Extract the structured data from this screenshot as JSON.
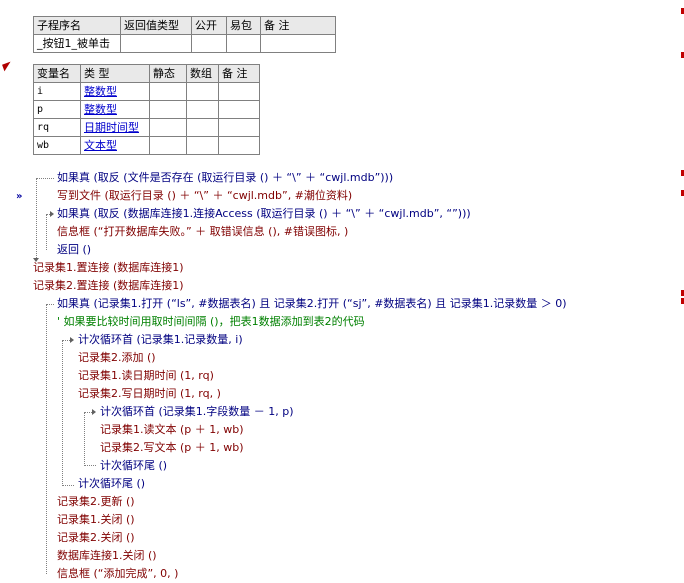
{
  "sub_table": {
    "headers": [
      "子程序名",
      "返回值类型",
      "公开",
      "易包",
      "备 注"
    ],
    "row": [
      "_按钮1_被单击",
      "",
      "",
      "",
      ""
    ]
  },
  "var_table": {
    "headers": [
      "变量名",
      "类 型",
      "静态",
      "数组",
      "备 注"
    ],
    "rows": [
      [
        "i",
        "整数型",
        "",
        "",
        ""
      ],
      [
        "p",
        "整数型",
        "",
        "",
        ""
      ],
      [
        "rq",
        "日期时间型",
        "",
        "",
        ""
      ],
      [
        "wb",
        "文本型",
        "",
        "",
        ""
      ]
    ]
  },
  "code": [
    "如果真 (取反 (文件是否存在 (取运行目录 () ＋ “\\” ＋ “cwjl.mdb”)))",
    "写到文件 (取运行目录 () ＋ “\\” ＋ “cwjl.mdb”, #潮位资料)",
    "如果真 (取反 (数据库连接1.连接Access (取运行目录 () ＋ “\\” ＋ “cwjl.mdb”, “”)))",
    "信息框 (“打开数据库失败。” ＋ 取错误信息 (), #错误图标, )",
    "返回 ()",
    "记录集1.置连接 (数据库连接1)",
    "记录集2.置连接 (数据库连接1)",
    "如果真 (记录集1.打开 (“ls”, #数据表名) 且 记录集2.打开 (“sj”, #数据表名) 且 记录集1.记录数量 ＞ 0)",
    "' 如果要比较时间用取时间间隔 ()，把表1数据添加到表2的代码",
    "计次循环首 (记录集1.记录数量, i)",
    "记录集2.添加 ()",
    "记录集1.读日期时间 (1, rq)",
    "记录集2.写日期时间 (1, rq, )",
    "计次循环首 (记录集1.字段数量 － 1, p)",
    "记录集1.读文本 (p ＋ 1, wb)",
    "记录集2.写文本 (p ＋ 1, wb)",
    "计次循环尾 ()",
    "计次循环尾 ()",
    "记录集2.更新 ()",
    "记录集1.关闭 ()",
    "记录集2.关闭 ()",
    "数据库连接1.关闭 ()",
    "信息框 (“添加完成”, 0, )"
  ],
  "gutter_markers": {
    "breakpoint_arrow": "»"
  },
  "colors": {
    "keyword": "#000080",
    "function": "#800000",
    "comment": "#008000",
    "type_link": "#0000cc",
    "table_border": "#808080",
    "header_bg": "#e9e9e9"
  }
}
